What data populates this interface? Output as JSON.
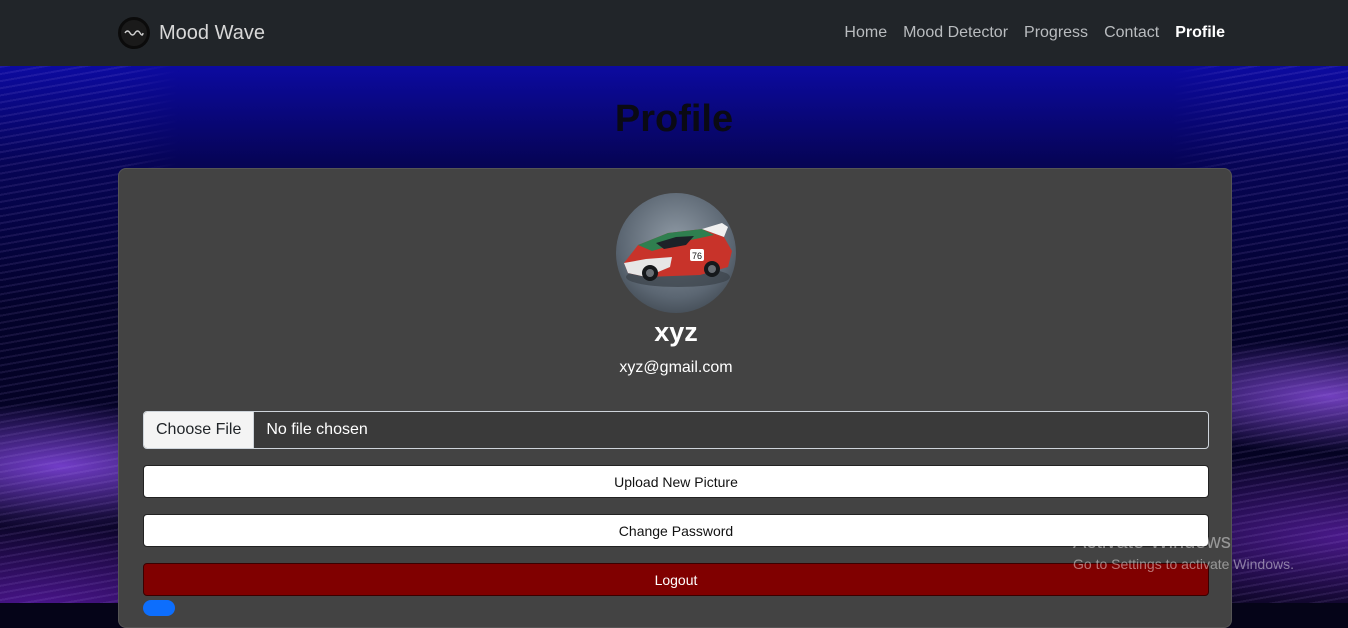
{
  "navbar": {
    "brand": "Mood Wave",
    "links": [
      {
        "label": "Home"
      },
      {
        "label": "Mood Detector"
      },
      {
        "label": "Progress"
      },
      {
        "label": "Contact"
      },
      {
        "label": "Profile",
        "active": true
      }
    ]
  },
  "page": {
    "title": "Profile"
  },
  "profile": {
    "username": "xyz",
    "email": "xyz@gmail.com",
    "avatar_icon": "race-car-photo"
  },
  "file_input": {
    "button_label": "Choose File",
    "status": "No file chosen"
  },
  "buttons": {
    "upload": "Upload New Picture",
    "change_password": "Change Password",
    "logout": "Logout"
  },
  "watermark": {
    "title": "Activate Windows",
    "subtitle": "Go to Settings to activate Windows."
  },
  "colors": {
    "navbar": "#212529",
    "card": "#434343",
    "logout": "#800000",
    "toggle": "#0d6efd"
  }
}
